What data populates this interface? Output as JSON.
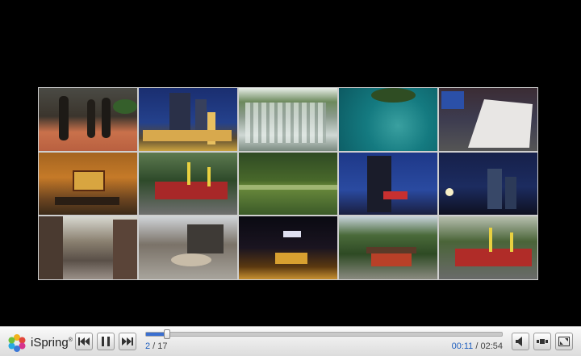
{
  "player": {
    "brand": "iSpring",
    "brand_mark": "®",
    "slide_current": "2",
    "slide_separator": " / ",
    "slide_total": "17",
    "time_current": "00:11",
    "time_separator": " / ",
    "time_total": "02:54",
    "progress": 0.06
  },
  "controls": {
    "prev_icon": "skip-back-icon",
    "pause_icon": "pause-icon",
    "next_icon": "skip-forward-icon",
    "volume_icon": "speaker-icon",
    "outline_icon": "slide-outline-icon",
    "fullscreen_icon": "fullscreen-icon"
  },
  "colors": {
    "accent": "#1f5fbf",
    "background": "#000000"
  },
  "photos": [
    {
      "subject": "bronze statues plaza"
    },
    {
      "subject": "night skyline"
    },
    {
      "subject": "waterfall"
    },
    {
      "subject": "turquoise water"
    },
    {
      "subject": "stone monument"
    },
    {
      "subject": "hotel lobby"
    },
    {
      "subject": "red gate green hills"
    },
    {
      "subject": "lake and forest"
    },
    {
      "subject": "skyscraper at dusk"
    },
    {
      "subject": "city at night"
    },
    {
      "subject": "old town street"
    },
    {
      "subject": "modern street"
    },
    {
      "subject": "night market"
    },
    {
      "subject": "temple in mountains"
    },
    {
      "subject": "festival gate"
    }
  ]
}
